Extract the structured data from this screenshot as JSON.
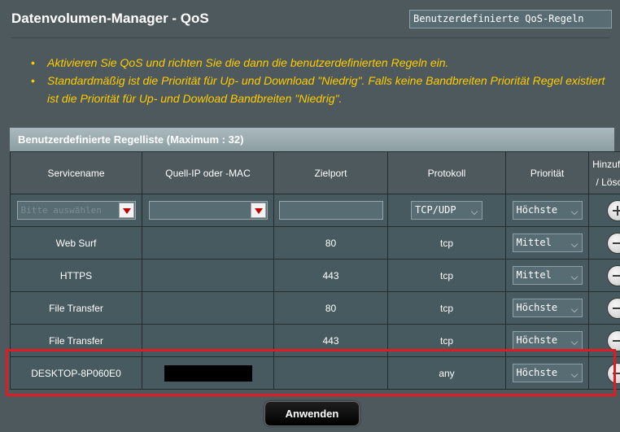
{
  "header": {
    "title": "Datenvolumen-Manager - QoS",
    "mode_select": "Benutzerdefinierte QoS-Regeln"
  },
  "notes": [
    "Aktivieren Sie QoS und richten Sie die dann die benutzerdefinierten Regeln ein.",
    "Standardmäßig ist die Priorität für Up- und Download \"Niedrig\". Falls keine Bandbreiten Priorität Regel existiert ist die Priorität für Up- und Dowload Bandbreiten \"Niedrig\"."
  ],
  "table": {
    "caption": "Benutzerdefinierte Regelliste (Maximum : 32)",
    "headers": {
      "service": "Servicename",
      "source": "Quell-IP oder -MAC",
      "port": "Zielport",
      "protocol": "Protokoll",
      "priority": "Priorität",
      "action_line1": "Hinzufügen",
      "action_line2": "/ Löschen"
    },
    "new_rule": {
      "service_placeholder": "Bitte auswählen",
      "protocol": "TCP/UDP",
      "priority": "Höchste"
    },
    "rows": [
      {
        "service": "Web Surf",
        "source": "",
        "port": "80",
        "protocol": "tcp",
        "priority": "Mittel"
      },
      {
        "service": "HTTPS",
        "source": "",
        "port": "443",
        "protocol": "tcp",
        "priority": "Mittel"
      },
      {
        "service": "File Transfer",
        "source": "",
        "port": "80",
        "protocol": "tcp",
        "priority": "Höchste"
      },
      {
        "service": "File Transfer",
        "source": "",
        "port": "443",
        "protocol": "tcp",
        "priority": "Höchste"
      },
      {
        "service": "DESKTOP-8P060E0",
        "source": "",
        "port": "",
        "protocol": "any",
        "priority": "Höchste"
      }
    ]
  },
  "apply_button": "Anwenden",
  "colors": {
    "background": "#4d595d",
    "notes_text": "#ffcc00",
    "highlight": "#e21b22"
  }
}
